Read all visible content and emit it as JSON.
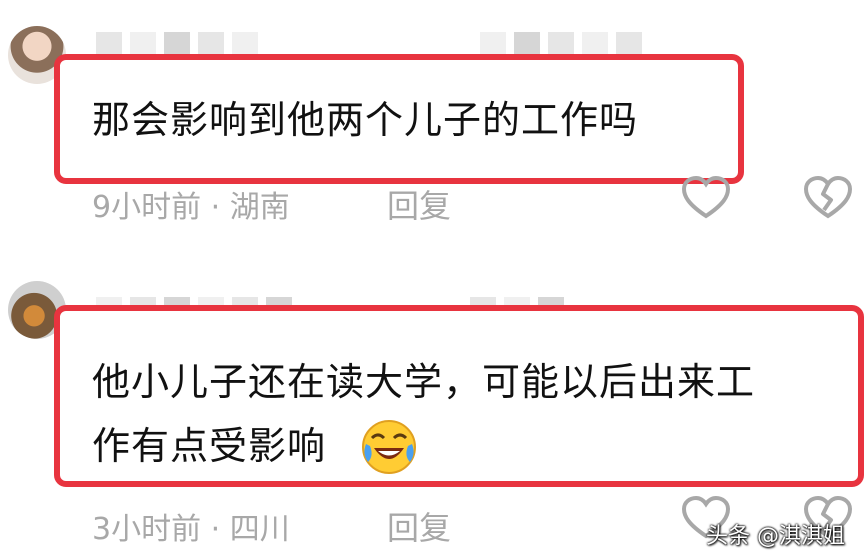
{
  "comments": [
    {
      "text": "那会影响到他两个儿子的工作吗",
      "meta": "9小时前 · 湖南",
      "reply_label": "回复",
      "avatar_icon": "user-avatar",
      "like_icon": "heart-outline-icon",
      "dislike_icon": "broken-heart-icon"
    },
    {
      "text_line1": "他小儿子还在读大学，可能以后出来工",
      "text_line2": "作有点受影响",
      "emoji_icon": "laughing-crying-emoji-icon",
      "meta": "3小时前 · 四川",
      "reply_label": "回复",
      "avatar_icon": "user-avatar",
      "like_icon": "heart-outline-icon",
      "dislike_icon": "broken-heart-icon"
    }
  ],
  "watermark": {
    "text": "头条 @淇淇姐"
  },
  "colors": {
    "highlight_border": "#e8343f",
    "meta_text": "#a8a8a8",
    "body_text": "#111111"
  }
}
